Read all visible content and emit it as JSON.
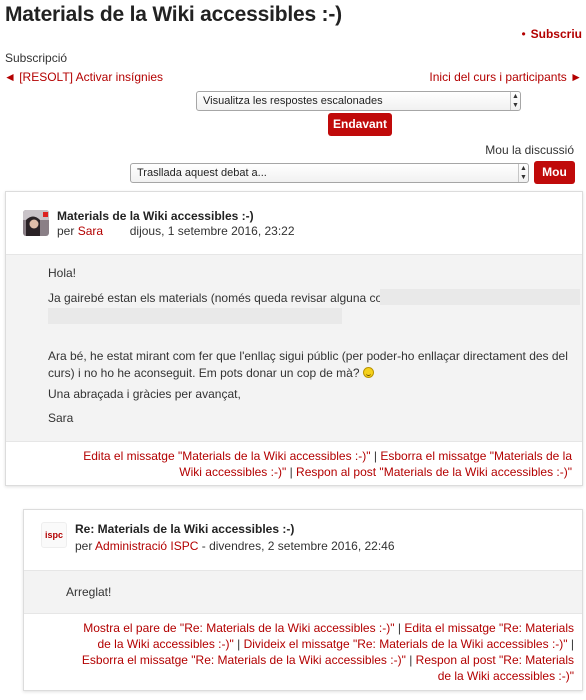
{
  "page": {
    "title": "Materials de la Wiki accessibles :-)",
    "subscribe_link": "Subscriu",
    "subscription_label": "Subscripció",
    "prev_link": "◄ [RESOLT] Activar insígnies",
    "next_link": "Inici del curs i participants ►"
  },
  "display": {
    "select_value": "Visualitza les respostes escalonades",
    "go_button": "Endavant"
  },
  "move": {
    "label": "Mou la discussió",
    "select_value": "Trasllada aquest debat a...",
    "button": "Mou"
  },
  "posts": [
    {
      "subject": "Materials de la Wiki accessibles :-)",
      "by": "per",
      "author": "Sara",
      "date": "dijous, 1 setembre 2016, 23:22",
      "paragraphs": [
        "Hola!",
        "Ja gairebé estan els materials (només queda revisar alguna coseta):",
        "Ara bé, he estat mirant com fer que l'enllaç sigui públic (per poder-ho enllaçar directament des del curs) i no ho he aconseguit. Em pots donar un cop de mà?",
        "Una abraçada i gràcies per avançat,",
        "Sara"
      ],
      "links": {
        "edit": "Edita el missatge \"Materials de la Wiki accessibles :-)\"",
        "delete": "Esborra el missatge \"Materials de la Wiki accessibles :-)\"",
        "reply": "Respon al post \"Materials de la Wiki accessibles :-)\"",
        "sep": "|"
      }
    },
    {
      "subject": "Re: Materials de la Wiki accessibles :-)",
      "by": "per",
      "author": "Administració ISPC",
      "date": "- divendres, 2 setembre 2016, 22:46",
      "avatar_text": "ispc",
      "paragraphs": [
        "Arreglat!"
      ],
      "links": {
        "parent": "Mostra el pare de \"Re: Materials de la Wiki accessibles :-)\"",
        "edit": "Edita el missatge \"Re: Materials de la Wiki accessibles :-)\"",
        "split": "Divideix el missatge \"Re: Materials de la Wiki accessibles :-)\"",
        "delete": "Esborra el missatge \"Re: Materials de la Wiki accessibles :-)\"",
        "reply": "Respon al post \"Re: Materials de la Wiki accessibles :-)\"",
        "sep": "|"
      }
    }
  ],
  "colors": {
    "accent": "#b30000",
    "button": "#c00a0a",
    "post_body": "#f3f3f3"
  }
}
